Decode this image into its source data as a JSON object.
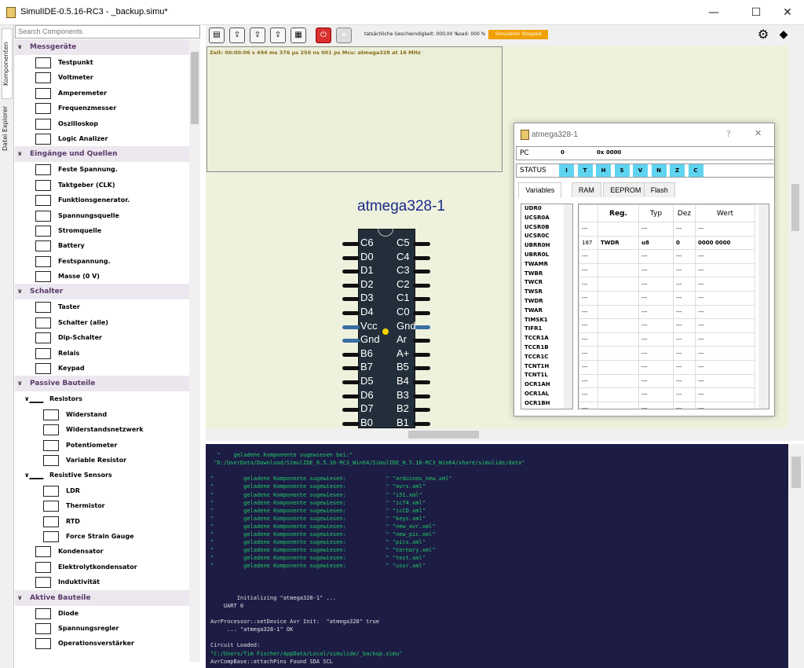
{
  "window": {
    "title": "SimulIDE-0.5.16-RC3  -  _backup.simu*"
  },
  "side_tabs": [
    "Komponenten",
    "Datei Explorer"
  ],
  "search": {
    "placeholder": "Search Components"
  },
  "categories": [
    {
      "label": "Messgeräte",
      "items": [
        "Testpunkt",
        "Voltmeter",
        "Amperemeter",
        "Frequenzmesser",
        "Oszilloskop",
        "Logic Analizer"
      ]
    },
    {
      "label": "Eingänge und Quellen",
      "items": [
        "Feste Spannung.",
        "Taktgeber (CLK)",
        "Funktionsgenerator.",
        "Spannungsquelle",
        "Stromquelle",
        "Battery",
        "Festspannung.",
        "Masse (0 V)"
      ]
    },
    {
      "label": "Schalter",
      "items": [
        "Taster",
        "Schalter (alle)",
        "Dip-Schalter",
        "Relais",
        "Keypad"
      ]
    },
    {
      "label": "Passive Bauteile",
      "sub1": "Resistors",
      "sub1_items": [
        "Widerstand",
        "Widerstandsnetzwerk",
        "Potentiometer",
        "Variable Resistor"
      ],
      "sub2": "Resistive Sensors",
      "sub2_items": [
        "LDR",
        "Thermistor",
        "RTD",
        "Force Strain Gauge"
      ],
      "items": [
        "Kondensator",
        "Elektrolytkondensator",
        "Induktivität"
      ]
    },
    {
      "label": "Aktive Bauteile",
      "items": [
        "Diode",
        "Spannungsregler",
        "Operationsverstärker"
      ]
    }
  ],
  "toolbar": {
    "speed": "tatsächliche Geschwindigkeit: 000,00 %",
    "load": "Load: 000 %",
    "sim_status": "Simulation Stopped"
  },
  "plot": {
    "info": "Zeit: 00:00:06 s  494 ms  376 µs  250 ns  001 ps      Mcu: atmega328 at 16 MHz"
  },
  "chip": {
    "label": "atmega328-1",
    "left_pins": [
      "C6",
      "D0",
      "D1",
      "D2",
      "D3",
      "D4",
      "Vcc",
      "Gnd",
      "B6",
      "B7",
      "D5",
      "D6",
      "D7",
      "B0"
    ],
    "right_pins": [
      "C5",
      "C4",
      "C3",
      "C2",
      "C1",
      "C0",
      "Gnd",
      "Ar",
      "A+",
      "B5",
      "B4",
      "B3",
      "B2",
      "B1"
    ]
  },
  "dialog": {
    "title": "atmega328-1",
    "help": "?",
    "close": "✕",
    "pc_label": "PC",
    "pc_value": "0",
    "pc_hex": "0x 0000",
    "status_label": "STATUS",
    "status_bits": [
      "I",
      "T",
      "H",
      "S",
      "V",
      "N",
      "Z",
      "C"
    ],
    "tabs": [
      "Variables",
      "RAM",
      "EEPROM",
      "Flash"
    ],
    "variables": [
      "UDR0",
      "UCSR0A",
      "UCSR0B",
      "UCSR0C",
      "UBRR0H",
      "UBRR0L",
      "TWAMR",
      "TWBR",
      "TWCR",
      "TWSR",
      "TWDR",
      "TWAR",
      "TIMSK1",
      "TIFR1",
      "TCCR1A",
      "TCCR1B",
      "TCCR1C",
      "TCNT1H",
      "TCNT1L",
      "OCR1AH",
      "OCR1AL",
      "OCR1BH"
    ],
    "table_headers": [
      "",
      "Reg.",
      "Typ",
      "Dez",
      "Wert"
    ],
    "table_rows": [
      [
        "---",
        "",
        "---",
        "---",
        "---"
      ],
      [
        "187",
        "TWDR",
        "u8",
        "0",
        "0000 0000"
      ],
      [
        "---",
        "",
        "---",
        "---",
        "---"
      ],
      [
        "---",
        "",
        "---",
        "---",
        "---"
      ],
      [
        "---",
        "",
        "---",
        "---",
        "---"
      ],
      [
        "---",
        "",
        "---",
        "---",
        "---"
      ],
      [
        "---",
        "",
        "---",
        "---",
        "---"
      ],
      [
        "---",
        "",
        "---",
        "---",
        "---"
      ],
      [
        "---",
        "",
        "---",
        "---",
        "---"
      ],
      [
        "---",
        "",
        "---",
        "---",
        "---"
      ],
      [
        "---",
        "",
        "---",
        "---",
        "---"
      ],
      [
        "---",
        "",
        "---",
        "---",
        "---"
      ],
      [
        "---",
        "",
        "---",
        "---",
        "---"
      ],
      [
        "---",
        "",
        "---",
        "---",
        "---"
      ]
    ]
  },
  "console": [
    {
      "t": "  \"    geladene Komponente sugewiesen bei:\"",
      "c": "g"
    },
    {
      "t": " \"D:/UserData/Download/SimulIDE_0.5.16-RC3_Win64/SimulIDE_0.5.16-RC3_Win64/share/simulide/data\"",
      "c": "g"
    },
    {
      "t": "",
      "c": "g"
    },
    {
      "t": "\"         geladene Komponente sugewiesen:            \" \"arduinos_new.xml\"",
      "c": "g"
    },
    {
      "t": "\"         geladene Komponente sugewiesen:            \" \"avrs.xml\"",
      "c": "g"
    },
    {
      "t": "\"         geladene Komponente sugewiesen:            \" \"i51.xml\"",
      "c": "g"
    },
    {
      "t": "\"         geladene Komponente sugewiesen:            \" \"ic74.xml\"",
      "c": "g"
    },
    {
      "t": "\"         geladene Komponente sugewiesen:            \" \"icCD.xml\"",
      "c": "g"
    },
    {
      "t": "\"         geladene Komponente sugewiesen:            \" \"keys.xml\"",
      "c": "g"
    },
    {
      "t": "\"         geladene Komponente sugewiesen:            \" \"new_avr.xml\"",
      "c": "g"
    },
    {
      "t": "\"         geladene Komponente sugewiesen:            \" \"new_pic.xml\"",
      "c": "g"
    },
    {
      "t": "\"         geladene Komponente sugewiesen:            \" \"pics.xml\"",
      "c": "g"
    },
    {
      "t": "\"         geladene Komponente sugewiesen:            \" \"ternary.xml\"",
      "c": "g"
    },
    {
      "t": "\"         geladene Komponente sugewiesen:            \" \"test.xml\"",
      "c": "g"
    },
    {
      "t": "\"         geladene Komponente sugewiesen:            \" \"ussr.xml\"",
      "c": "g"
    },
    {
      "t": "",
      "c": "w"
    },
    {
      "t": "",
      "c": "w"
    },
    {
      "t": "",
      "c": "w"
    },
    {
      "t": "        Initializing \"atmega328-1\" ...",
      "c": "w"
    },
    {
      "t": "    UART 0",
      "c": "w"
    },
    {
      "t": "",
      "c": "w"
    },
    {
      "t": "AvrProcessor::setDevice Avr Init:  \"atmega328\" true",
      "c": "w"
    },
    {
      "t": "     ... \"atmega328-1\" OK",
      "c": "w"
    },
    {
      "t": "",
      "c": "w"
    },
    {
      "t": "Circuit Loaded:",
      "c": "w"
    },
    {
      "t": "\"C:/Users/Tim Fischer/AppData/Local/simulide/_backup.simu\"",
      "c": "g"
    },
    {
      "t": "AvrCompBase::attachPins Found SDA SCL",
      "c": "w"
    }
  ]
}
